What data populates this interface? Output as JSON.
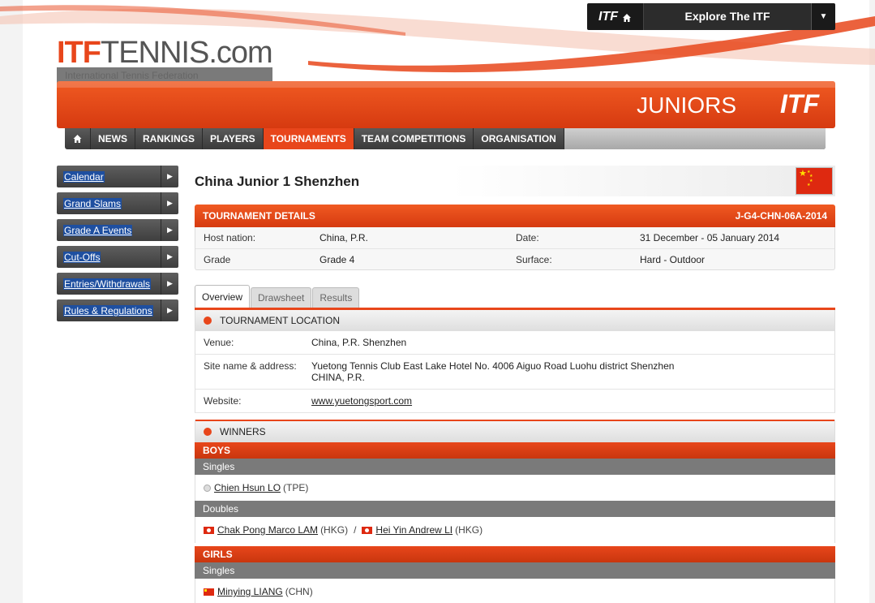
{
  "explore": {
    "itf": "ITF",
    "label": "Explore The ITF"
  },
  "logo": {
    "itf": "ITF",
    "tennis": "TENNIS.com",
    "subtitle": "International Tennis Federation"
  },
  "banner": {
    "juniors": "JUNIORS",
    "itf": "ITF"
  },
  "nav": {
    "items": [
      "NEWS",
      "RANKINGS",
      "PLAYERS",
      "TOURNAMENTS",
      "TEAM COMPETITIONS",
      "ORGANISATION"
    ]
  },
  "sidebar": {
    "items": [
      "Calendar",
      "Grand Slams",
      "Grade A Events",
      "Cut-Offs",
      "Entries/Withdrawals",
      "Rules & Regulations"
    ]
  },
  "tournament": {
    "title": "China Junior 1 Shenzhen",
    "details_label": "TOURNAMENT DETAILS",
    "code": "J-G4-CHN-06A-2014",
    "host_label": "Host nation:",
    "host": "China, P.R.",
    "date_label": "Date:",
    "date": "31 December - 05 January 2014",
    "grade_label": "Grade",
    "grade": "Grade 4",
    "surface_label": "Surface:",
    "surface": "Hard - Outdoor"
  },
  "tabs": [
    "Overview",
    "Drawsheet",
    "Results"
  ],
  "location": {
    "heading": "TOURNAMENT LOCATION",
    "venue_label": "Venue:",
    "venue": "China, P.R. Shenzhen",
    "site_label": "Site name & address:",
    "site_line1": "Yuetong Tennis Club East Lake Hotel No. 4006 Aiguo Road Luohu district Shenzhen",
    "site_line2": "CHINA, P.R.",
    "website_label": "Website:",
    "website": "www.yuetongsport.com"
  },
  "winners": {
    "heading": "WINNERS",
    "boys": "BOYS",
    "girls": "GIRLS",
    "singles": "Singles",
    "doubles": "Doubles",
    "boys_singles": {
      "name": "Chien Hsun LO",
      "nation": "(TPE)"
    },
    "boys_doubles": [
      {
        "name": "Chak Pong Marco LAM",
        "nation": "(HKG)"
      },
      {
        "name": "Hei Yin Andrew LI",
        "nation": "(HKG)"
      }
    ],
    "separator": "/",
    "girls_singles": {
      "name": "Minying LIANG",
      "nation": "(CHN)"
    }
  },
  "colors": {
    "accent": "#e8461b",
    "dark": "#3e3e3e",
    "link_highlight": "#1e4fa0"
  }
}
